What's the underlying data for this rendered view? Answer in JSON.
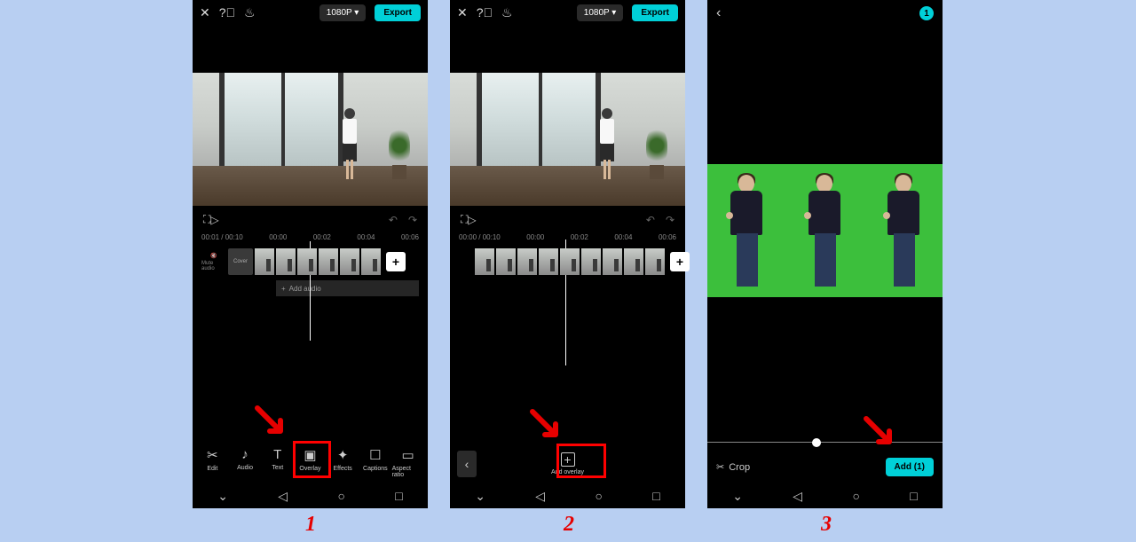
{
  "steps": {
    "one": "1",
    "two": "2",
    "three": "3"
  },
  "header": {
    "resolution": "1080P ▾",
    "export": "Export"
  },
  "timecode": {
    "current": "00:01",
    "total": "00:10",
    "t0": "00:00",
    "t2": "00:02",
    "t4": "00:04",
    "t6": "00:06"
  },
  "p2_timecode": {
    "current": "00:00",
    "total": "00:10"
  },
  "tracks": {
    "mute": "Mute audio",
    "cover": "Cover",
    "add_audio": "Add audio"
  },
  "tools": {
    "edit": "Edit",
    "audio": "Audio",
    "text": "Text",
    "overlay": "Overlay",
    "effects": "Effects",
    "captions": "Captions",
    "aspect": "Aspect ratio",
    "add_overlay": "Add overlay"
  },
  "p3": {
    "badge": "1",
    "crop": "Crop",
    "add": "Add (1)"
  }
}
